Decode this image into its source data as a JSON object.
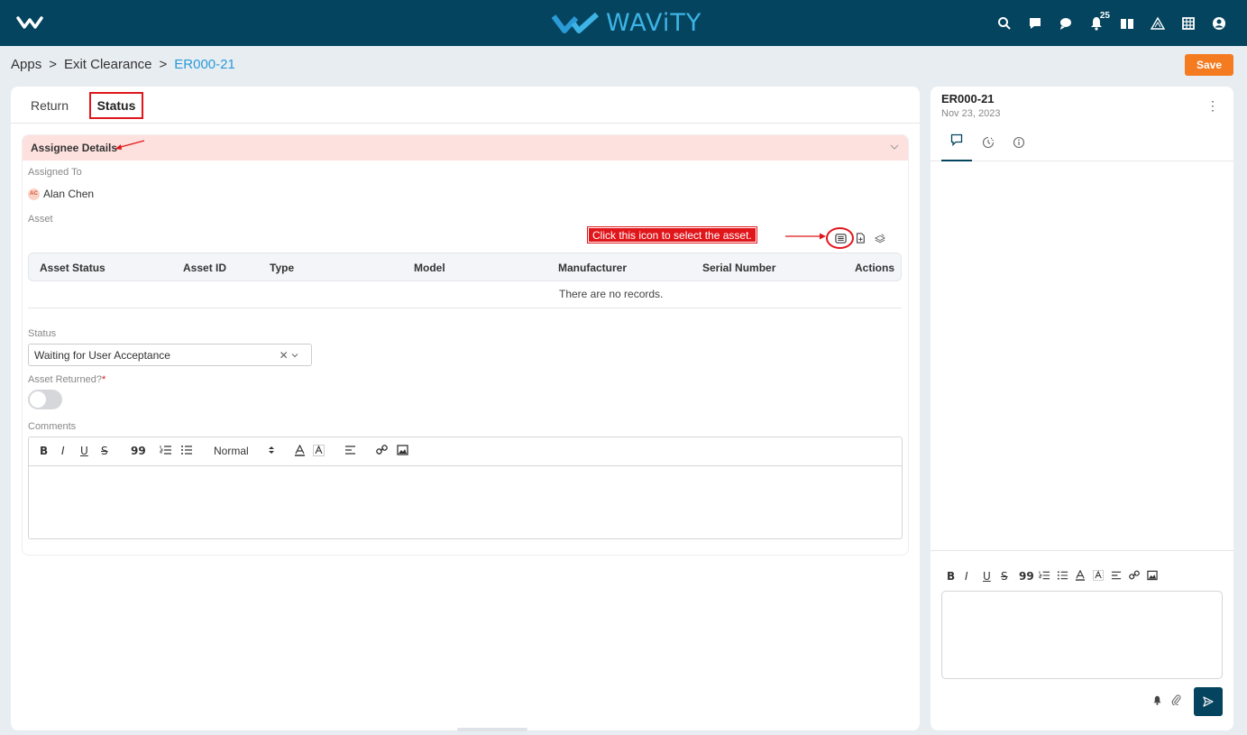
{
  "header": {
    "brand": "WAViTY",
    "notification_count": "25",
    "icons": [
      "search-icon",
      "chat-icon",
      "comment-icon",
      "bell-icon",
      "book-icon",
      "warning-icon",
      "grid-icon",
      "user-icon"
    ]
  },
  "breadcrumb": {
    "items": [
      "Apps",
      "Exit Clearance",
      "ER000-21"
    ],
    "separator": ">"
  },
  "actions": {
    "save_label": "Save"
  },
  "tabs": [
    {
      "label": "Return"
    },
    {
      "label": "Status"
    }
  ],
  "section": {
    "title": "Assignee Details",
    "assigned_to_label": "Assigned To",
    "assignee": {
      "initials": "AC",
      "name": "Alan Chen"
    },
    "asset_label": "Asset",
    "callout": "Click this icon to select the asset.",
    "table": {
      "columns": [
        "Asset Status",
        "Asset ID",
        "Type",
        "Model",
        "Manufacturer",
        "Serial Number",
        "Actions"
      ],
      "empty": "There are no records."
    },
    "status_label": "Status",
    "status_value": "Waiting for User Acceptance",
    "asset_returned_label": "Asset Returned?",
    "required_mark": "*",
    "asset_returned": false,
    "comments_label": "Comments",
    "editor_toolbar": {
      "bold": "B",
      "italic": "I",
      "underline": "U",
      "strike": "S",
      "quote": "99",
      "format": "Normal"
    }
  },
  "side_panel": {
    "record_id": "ER000-21",
    "date": "Nov 23, 2023",
    "tabs": [
      "comment-icon",
      "history-icon",
      "info-icon"
    ],
    "toolbar": {
      "bold": "B",
      "italic": "I",
      "underline": "U",
      "strike": "S",
      "quote": "99"
    }
  },
  "colors": {
    "topbar": "#05445e",
    "accent": "#2a9bd6",
    "save": "#f47b20",
    "highlight": "#e0161b",
    "section_head": "#fde1de"
  }
}
